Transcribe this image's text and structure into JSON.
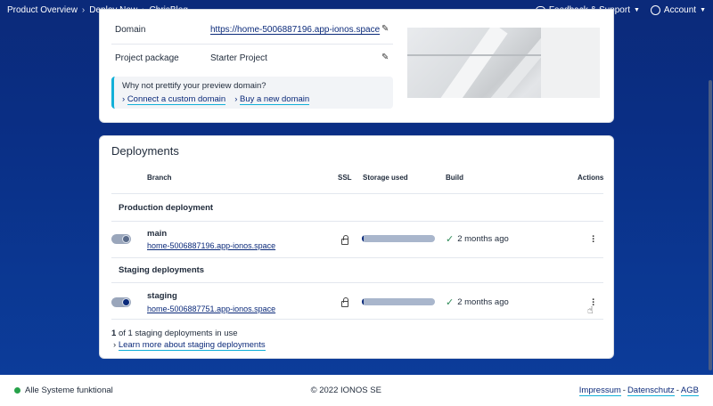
{
  "breadcrumb": [
    "Product Overview",
    "Deploy Now",
    "ChrisBlog"
  ],
  "header": {
    "feedback_label": "Feedback & Support",
    "account_label": "Account"
  },
  "project": {
    "domain_label": "Domain",
    "domain_value": "https://home-5006887196.app-ionos.space",
    "package_label": "Project package",
    "package_value": "Starter Project",
    "promo_title": "Why not prettify your preview domain?",
    "promo_link_connect": "Connect a custom domain",
    "promo_link_buy": "Buy a new domain"
  },
  "deployments": {
    "title": "Deployments",
    "columns": {
      "branch": "Branch",
      "ssl": "SSL",
      "storage": "Storage used",
      "build": "Build",
      "actions": "Actions"
    },
    "production_heading": "Production deployment",
    "staging_heading": "Staging deployments",
    "rows": [
      {
        "branch": "main",
        "url": "home-5006887196.app-ionos.space",
        "storage_fraction": 0.03,
        "build": "2 months ago"
      },
      {
        "branch": "staging",
        "url": "home-5006887751.app-ionos.space",
        "storage_fraction": 0.03,
        "build": "2 months ago"
      }
    ],
    "staging_count": "1",
    "staging_usage_text": "of 1 staging deployments in use",
    "learn_more": "Learn more about staging deployments"
  },
  "footer": {
    "status": "Alle Systeme funktional",
    "copyright": "© 2022 IONOS SE",
    "impressum": "Impressum",
    "datenschutz": "Datenschutz",
    "agb": "AGB"
  },
  "colors": {
    "brand": "#0b2a7a",
    "accent": "#12b0d8",
    "success": "#27a24a"
  }
}
